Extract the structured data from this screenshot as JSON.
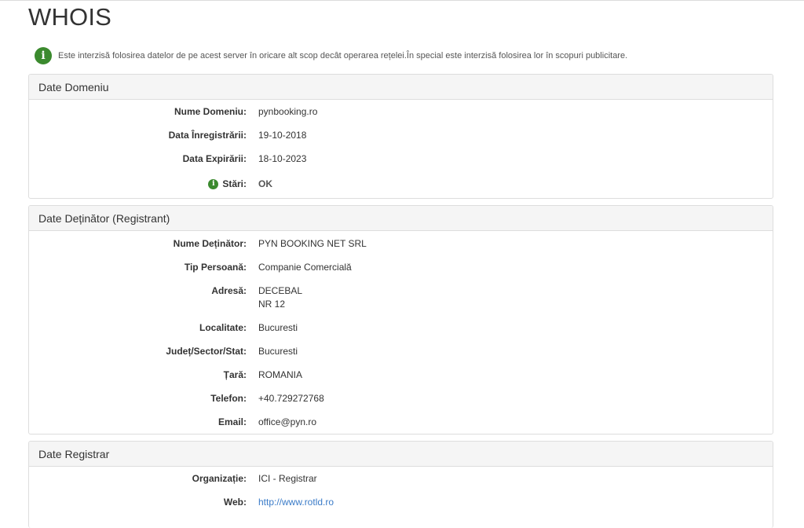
{
  "page": {
    "title": "WHOIS",
    "notice": "Este interzisă folosirea datelor de pe acest server în oricare alt scop decât operarea rețelei.În special este interzisă folosirea lor în scopuri publicitare."
  },
  "icons": {
    "notice_icon": "info-icon",
    "status_icon": "info-icon",
    "accent_color": "#3b8a2e",
    "link_color": "#3a7bc8"
  },
  "domain": {
    "heading": "Date Domeniu",
    "rows": [
      {
        "label": "Nume Domeniu:",
        "value": "pynbooking.ro"
      },
      {
        "label": "Data Înregistrării:",
        "value": "19-10-2018"
      },
      {
        "label": "Data Expirării:",
        "value": "18-10-2023"
      },
      {
        "label": "Stări:",
        "value": "OK"
      }
    ]
  },
  "registrant": {
    "heading": "Date Deținător (Registrant)",
    "rows": [
      {
        "label": "Nume Deținător:",
        "value": "PYN BOOKING NET SRL"
      },
      {
        "label": "Tip Persoană:",
        "value": "Companie Comercială"
      },
      {
        "label": "Adresă:",
        "value": "DECEBAL",
        "value2": "NR 12"
      },
      {
        "label": "Localitate:",
        "value": "Bucuresti"
      },
      {
        "label": "Județ/Sector/Stat:",
        "value": "Bucuresti"
      },
      {
        "label": "Țară:",
        "value": "ROMANIA"
      },
      {
        "label": "Telefon:",
        "value": "+40.729272768"
      },
      {
        "label": "Email:",
        "value": "office@pyn.ro"
      }
    ]
  },
  "registrar": {
    "heading": "Date Registrar",
    "rows": [
      {
        "label": "Organizație:",
        "value": "ICI - Registrar"
      },
      {
        "label": "Web:",
        "value": "http://www.rotld.ro"
      }
    ]
  }
}
